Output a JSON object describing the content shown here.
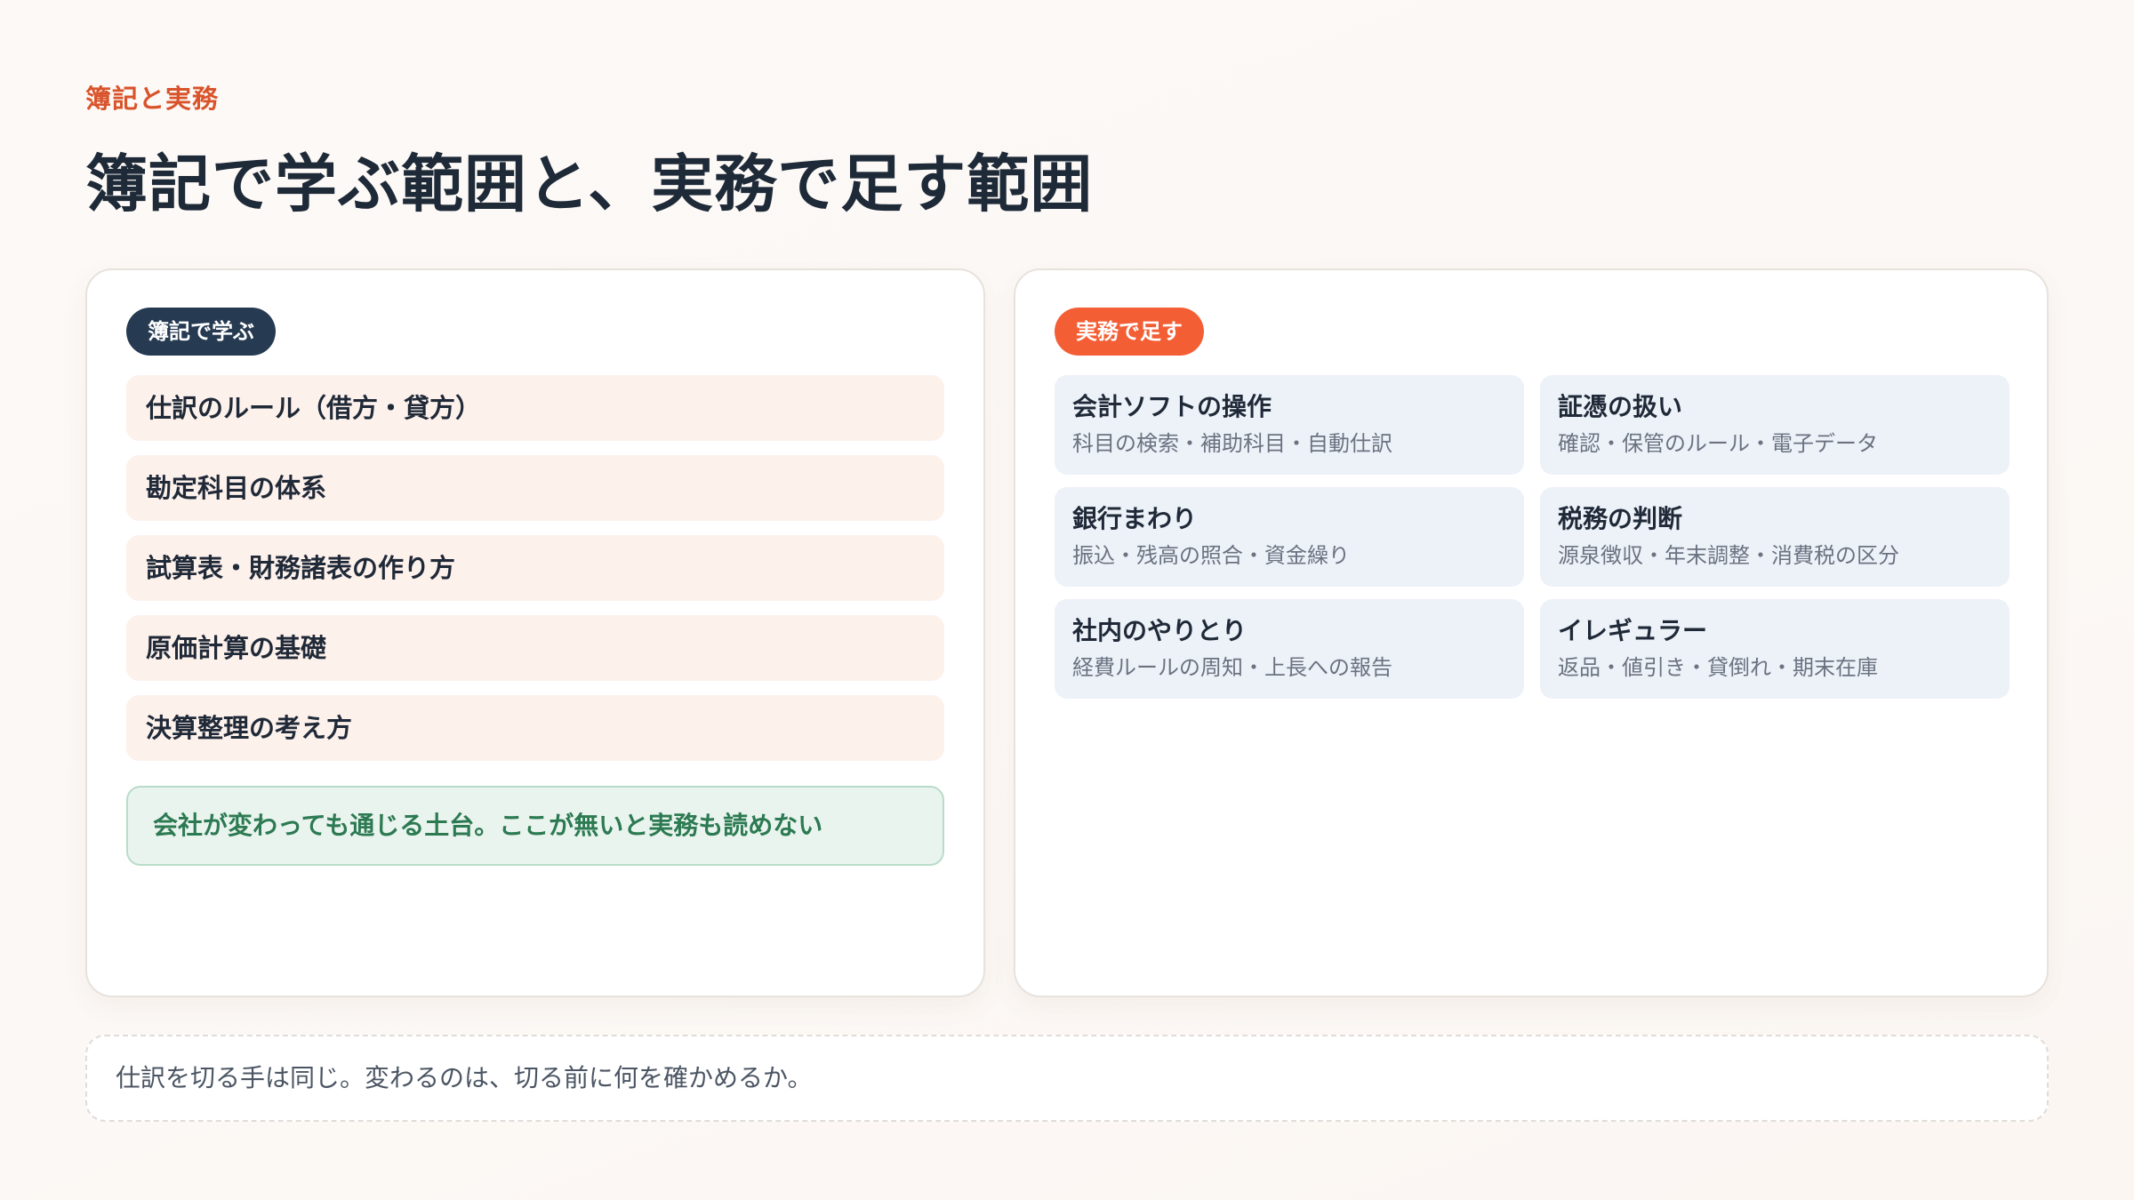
{
  "header": {
    "kicker": "簿記と実務",
    "title": "簿記で学ぶ範囲と、実務で足す範囲"
  },
  "left_card": {
    "badge": "簿記で学ぶ",
    "items": [
      "仕訳のルール（借方・貸方）",
      "勘定科目の体系",
      "試算表・財務諸表の作り方",
      "原価計算の基礎",
      "決算整理の考え方"
    ],
    "note": "会社が変わっても通じる土台。ここが無いと実務も読めない"
  },
  "right_card": {
    "badge": "実務で足す",
    "tiles": [
      {
        "title": "会計ソフトの操作",
        "desc": "科目の検索・補助科目・自動仕訳"
      },
      {
        "title": "証憑の扱い",
        "desc": "確認・保管のルール・電子データ"
      },
      {
        "title": "銀行まわり",
        "desc": "振込・残高の照合・資金繰り"
      },
      {
        "title": "税務の判断",
        "desc": "源泉徴収・年末調整・消費税の区分"
      },
      {
        "title": "社内のやりとり",
        "desc": "経費ルールの周知・上長への報告"
      },
      {
        "title": "イレギュラー",
        "desc": "返品・値引き・貸倒れ・期末在庫"
      }
    ]
  },
  "footer": {
    "text": "仕訳を切る手は同じ。変わるのは、切る前に何を確かめるか。"
  },
  "colors": {
    "accent": "#d9532b",
    "badge_dark": "#263a52",
    "badge_orange": "#f35e34",
    "note_green": "#2c7a52"
  }
}
